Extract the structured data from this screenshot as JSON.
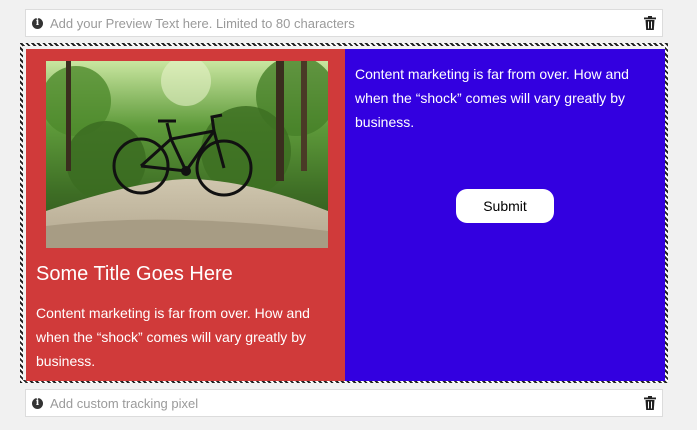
{
  "preview_bar": {
    "placeholder": "Add your Preview Text here. Limited to 80 characters",
    "info_icon": "info-icon",
    "delete_icon": "trash-icon"
  },
  "content_block": {
    "left_column": {
      "image": "bicycle-on-forest-path",
      "title": "Some Title Goes Here",
      "body": "Content marketing is far from over. How and when the “shock” comes will vary greatly by business.",
      "background": "#d03a3a"
    },
    "right_column": {
      "body": "Content marketing is far from over. How and when the “shock” comes will vary greatly by business.",
      "button_label": "Submit",
      "background": "#3300e0"
    }
  },
  "tracking_bar": {
    "placeholder": "Add custom tracking pixel",
    "info_icon": "info-icon",
    "delete_icon": "trash-icon"
  }
}
